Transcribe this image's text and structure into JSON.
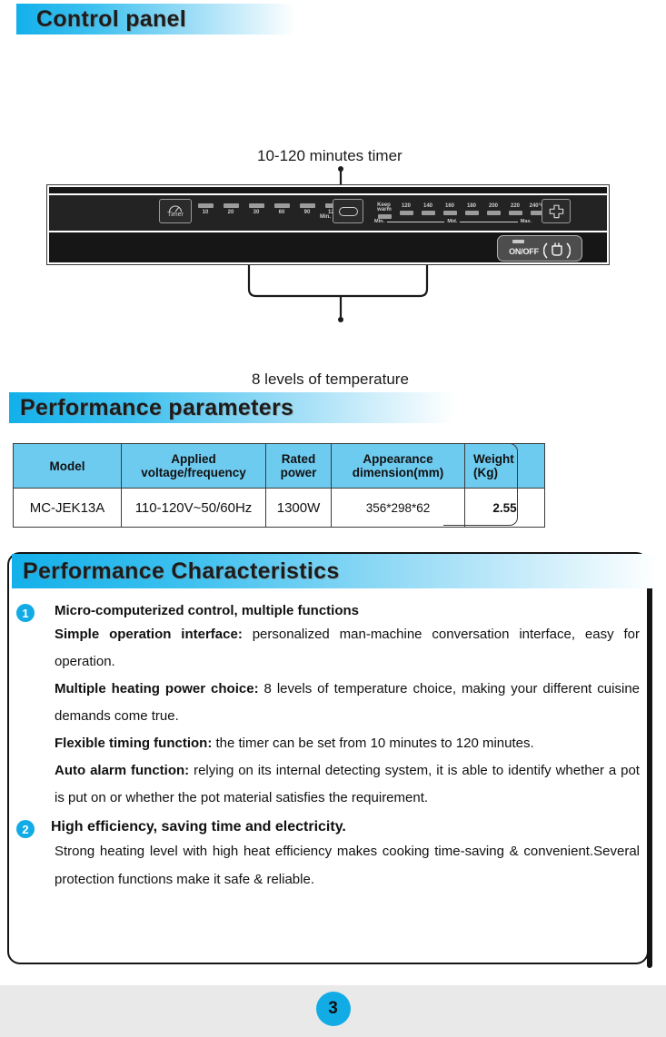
{
  "sections": {
    "control_panel": {
      "title": "Control panel"
    },
    "performance_parameters": {
      "title": "Performance parameters"
    },
    "performance_characteristics": {
      "title": "Performance Characteristics"
    }
  },
  "diagram": {
    "callout_top": "10-120 minutes timer",
    "callout_bottom": "8 levels of temperature",
    "timer_button_label": "Timer",
    "timer_leds": [
      "10",
      "20",
      "30",
      "60",
      "90",
      "120"
    ],
    "timer_unit": "Min.",
    "temp_leds": [
      "Keep\nwarm",
      "120",
      "140",
      "160",
      "180",
      "200",
      "220",
      "240°C"
    ],
    "temp_scale": {
      "min": "Min.",
      "mid": "Mid.",
      "max": "Max."
    },
    "onoff_label": "ON/OFF"
  },
  "table": {
    "headers": [
      "Model",
      "Applied\nvoltage/frequency",
      "Rated\npower",
      "Appearance\ndimension(mm)",
      "Weight\n(Kg)"
    ],
    "rows": [
      [
        "MC-JEK13A",
        "110-120V~50/60Hz",
        "1300W",
        "356*298*62",
        "2.55"
      ]
    ]
  },
  "features": [
    {
      "number": "1",
      "heading": "Micro-computerized control, multiple functions",
      "paragraphs": [
        {
          "lead": "Simple operation interface:",
          "text": " personalized man-machine conversation interface, easy for operation."
        },
        {
          "lead": "Multiple heating power choice:",
          "text": " 8 levels of temperature choice, making your different cuisine demands come true."
        },
        {
          "lead": "Flexible timing function:",
          "text": " the timer can be set from 10 minutes to 120 minutes."
        },
        {
          "lead": "Auto alarm function:",
          "text": " relying on its internal detecting system, it is able to identify whether a pot is put on or whether the pot material satisfies the requirement."
        }
      ]
    },
    {
      "number": "2",
      "heading": "High efficiency, saving time and electricity.",
      "paragraphs": [
        {
          "lead": "",
          "text": "Strong heating level with high heat efficiency makes cooking time-saving & convenient.Several protection functions make it safe & reliable."
        }
      ]
    }
  ],
  "footer": {
    "page_number": "3"
  },
  "colors": {
    "accent_blue": "#11ace5",
    "header_blue": "#13b0ea",
    "table_header_blue": "#6ecbf0",
    "panel_dark": "#232323",
    "footer_gray": "#e9e9e9"
  }
}
